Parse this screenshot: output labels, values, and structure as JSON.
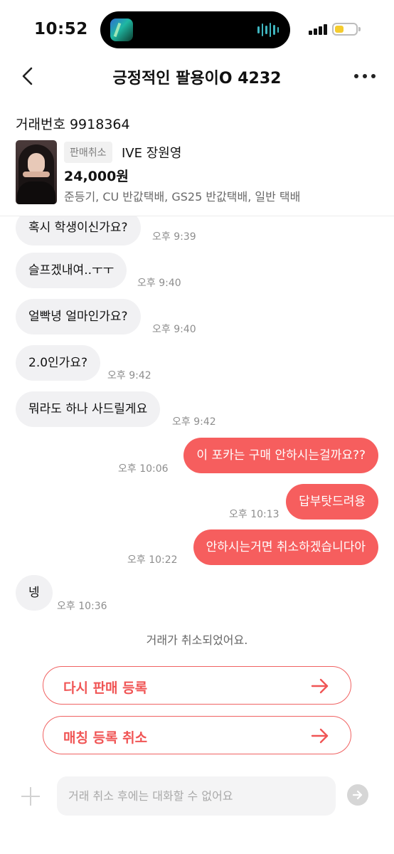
{
  "status_bar": {
    "time": "10:52"
  },
  "header": {
    "title": "긍정적인 팔용이O 4232"
  },
  "trade": {
    "number_label": "거래번호 9918364",
    "badge": "판매취소",
    "item_name": "IVE 장원영",
    "price": "24,000원",
    "methods": "준등기, CU 반값택배, GS25 반값택배, 일반 택배"
  },
  "messages": [
    {
      "side": "in",
      "text": "혹시 학생이신가요?",
      "time": "오후 9:39"
    },
    {
      "side": "in",
      "text": "슬프겠내여..ㅜㅜ",
      "time": "오후 9:40"
    },
    {
      "side": "in",
      "text": "얼빡녕 얼마인가요?",
      "time": "오후 9:40"
    },
    {
      "side": "in",
      "text": "2.0인가요?",
      "time": "오후 9:42"
    },
    {
      "side": "in",
      "text": "뭐라도 하나 사드릴게요",
      "time": "오후 9:42"
    },
    {
      "side": "out",
      "text": "이 포카는 구매 안하시는걸까요??",
      "time": "오후 10:06"
    },
    {
      "side": "out",
      "text": "답부탓드려용",
      "time": "오후 10:13"
    },
    {
      "side": "out",
      "text": "안하시는거면 취소하겠습니다아",
      "time": "오후 10:22"
    },
    {
      "side": "in",
      "text": "넹",
      "time": "오후 10:36"
    }
  ],
  "notice": "거래가 취소되었어요.",
  "actions": {
    "relist": "다시 판매 등록",
    "cancel_matching": "매칭 등록 취소"
  },
  "input": {
    "placeholder": "거래 취소 후에는 대화할 수 없어요"
  },
  "colors": {
    "accent": "#f65e5e",
    "incoming_bubble": "#f1f1f3",
    "battery": "#f5cc2e"
  },
  "icons": {
    "back": "chevron-left-icon",
    "more": "more-horizontal-icon",
    "arrow": "arrow-right-icon",
    "attach": "plus-icon",
    "send": "send-arrow-icon"
  }
}
